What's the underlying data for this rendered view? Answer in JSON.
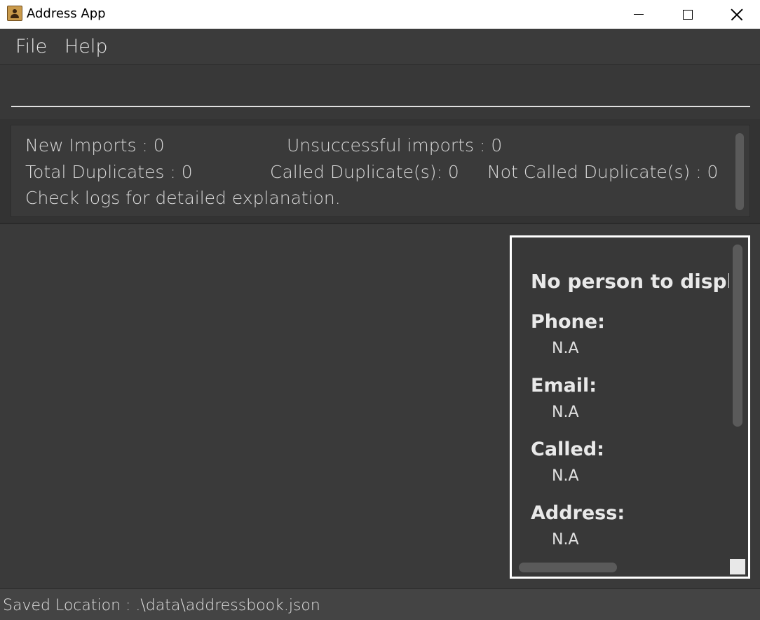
{
  "window": {
    "title": "Address App",
    "icon": "address-book-icon"
  },
  "menu": {
    "items": [
      {
        "label": "File"
      },
      {
        "label": "Help"
      }
    ]
  },
  "command": {
    "value": "",
    "placeholder": ""
  },
  "result": {
    "new_imports": "New Imports : 0",
    "unsuccessful_imports": "Unsuccessful imports : 0",
    "total_duplicates": "Total Duplicates : 0",
    "called_duplicates": "Called Duplicate(s): 0",
    "not_called_duplicates": "Not Called Duplicate(s) : 0",
    "hint": "Check logs for detailed explanation."
  },
  "person_detail": {
    "title": "No person to display",
    "fields": [
      {
        "label": "Phone:",
        "value": "N.A"
      },
      {
        "label": "Email:",
        "value": "N.A"
      },
      {
        "label": "Called:",
        "value": "N.A"
      },
      {
        "label": "Address:",
        "value": "N.A"
      }
    ]
  },
  "status": {
    "saved_location": "Saved Location : .\\data\\addressbook.json"
  },
  "colors": {
    "background": "#3a3a3a",
    "menubar": "#3b3b3b",
    "text": "#e6e6e6",
    "panel_border": "#ffffff"
  }
}
